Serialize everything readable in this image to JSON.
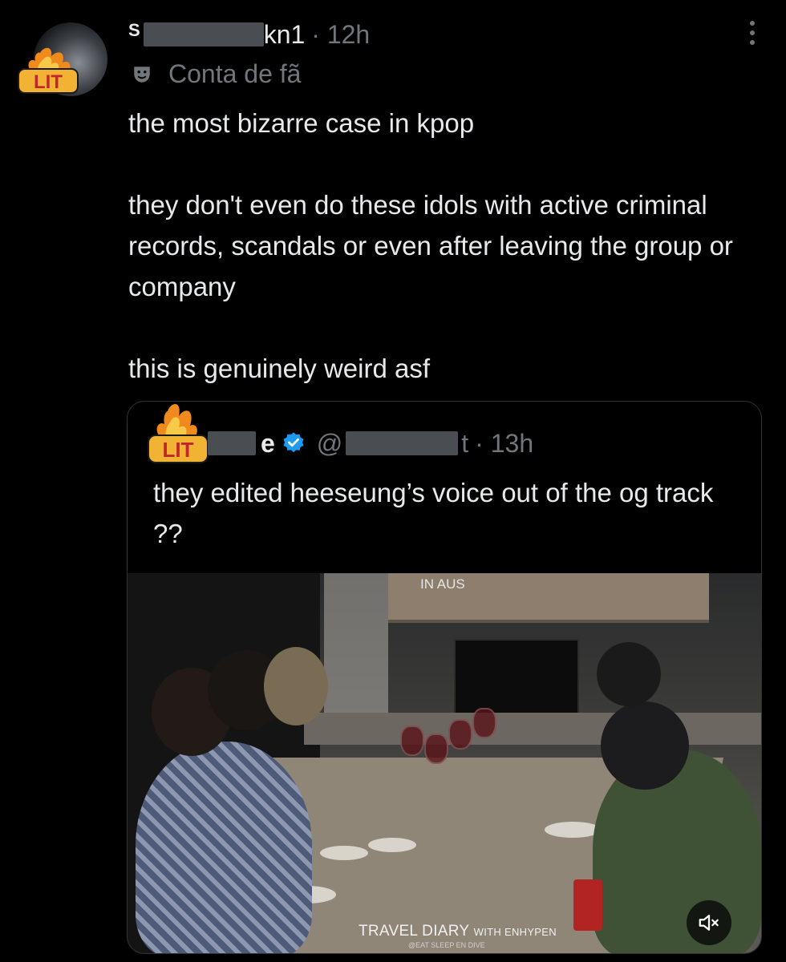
{
  "tweet": {
    "name_start": "S",
    "handle_end": "kn1",
    "time": "· 12h",
    "fan_label": "Conta de fã",
    "text_lines": [
      "the most bizarre case in kpop",
      "they don't even do these idols with active criminal records, scandals or even after leaving the group or company",
      "this is genuinely weird asf"
    ],
    "badge_text": "LIT"
  },
  "quote": {
    "name_end": "e",
    "at_sign": "@",
    "handle_end": "t",
    "time": "· 13h",
    "text": "they edited heeseung’s voice out of the og track ??",
    "badge_text": "LIT",
    "video": {
      "top_label": "IN AUS",
      "caption_main": "TRAVEL DIARY",
      "caption_small": "WITH ENHYPEN",
      "caption_sub": "@EAT SLEEP EN DIVE"
    }
  },
  "icons": {
    "more": "more-dots-icon",
    "fan": "theater-mask-icon",
    "verified": "verified-badge-icon",
    "mute": "speaker-muted-icon"
  },
  "colors": {
    "background": "#000000",
    "text": "#e7e9ea",
    "muted": "#71767b",
    "verified": "#1d9bf0",
    "lit_badge": "#f2b233"
  }
}
